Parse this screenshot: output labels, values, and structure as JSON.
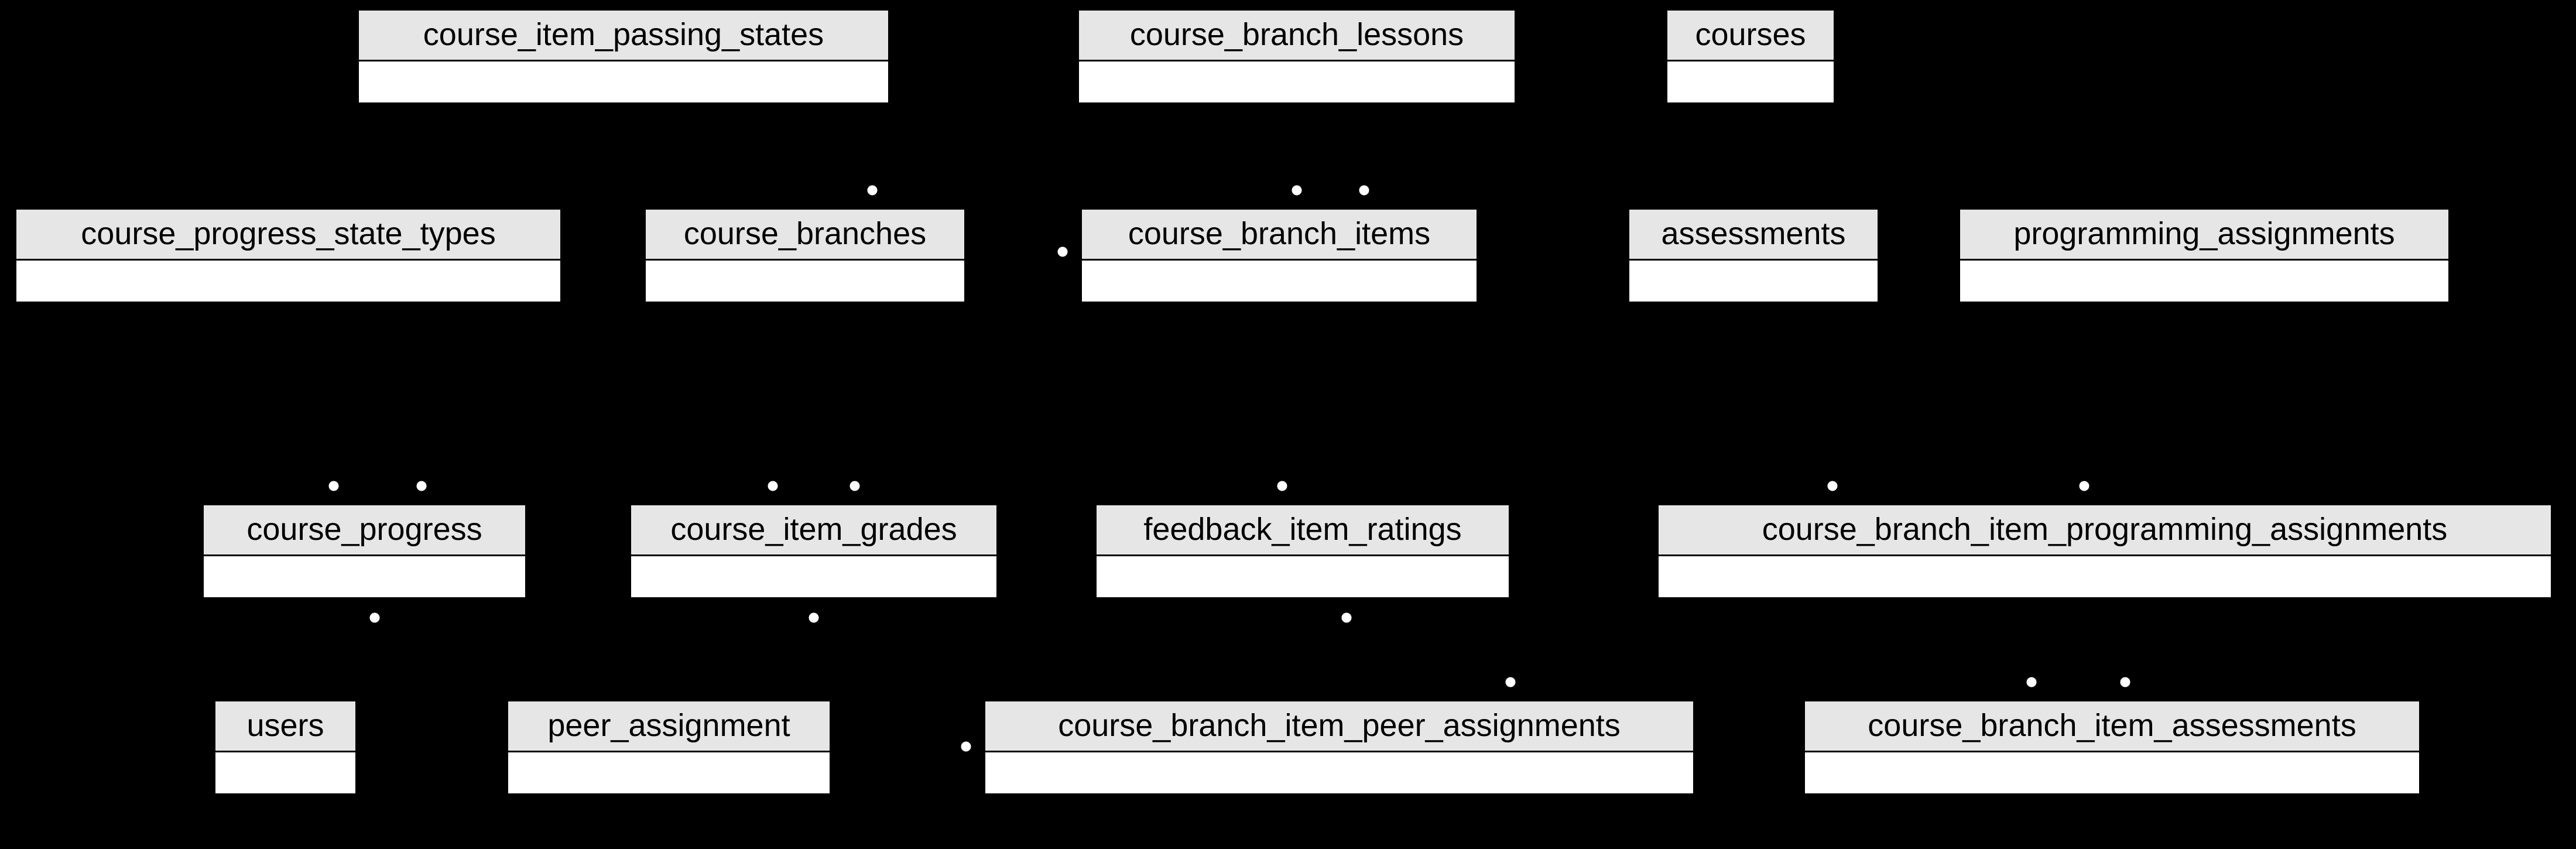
{
  "diagram": {
    "type": "entity-relationship",
    "entities": {
      "course_item_passing_states": {
        "label": "course_item_passing_states"
      },
      "course_branch_lessons": {
        "label": "course_branch_lessons"
      },
      "courses": {
        "label": "courses"
      },
      "course_progress_state_types": {
        "label": "course_progress_state_types"
      },
      "course_branches": {
        "label": "course_branches"
      },
      "course_branch_items": {
        "label": "course_branch_items"
      },
      "assessments": {
        "label": "assessments"
      },
      "programming_assignments": {
        "label": "programming_assignments"
      },
      "course_progress": {
        "label": "course_progress"
      },
      "course_item_grades": {
        "label": "course_item_grades"
      },
      "feedback_item_ratings": {
        "label": "feedback_item_ratings"
      },
      "course_branch_item_programming_assignments": {
        "label": "course_branch_item_programming_assignments"
      },
      "users": {
        "label": "users"
      },
      "peer_assignment": {
        "label": "peer_assignment"
      },
      "course_branch_item_peer_assignments": {
        "label": "course_branch_item_peer_assignments"
      },
      "course_branch_item_assessments": {
        "label": "course_branch_item_assessments"
      }
    },
    "edges": [
      {
        "from": "course_branch_lessons",
        "to": "course_branch_items"
      },
      {
        "from": "courses",
        "to": "course_branches"
      },
      {
        "from": "courses",
        "to": "course_branch_items"
      },
      {
        "from": "course_branches",
        "to": "course_branch_items"
      },
      {
        "from": "course_item_passing_states",
        "to": "course_item_grades"
      },
      {
        "from": "course_progress_state_types",
        "to": "course_progress"
      },
      {
        "from": "course_branch_items",
        "to": "course_progress"
      },
      {
        "from": "course_branch_items",
        "to": "course_item_grades"
      },
      {
        "from": "course_branch_items",
        "to": "feedback_item_ratings"
      },
      {
        "from": "course_branch_items",
        "to": "course_branch_item_programming_assignments"
      },
      {
        "from": "course_branch_items",
        "to": "course_branch_item_peer_assignments"
      },
      {
        "from": "course_branch_items",
        "to": "course_branch_item_assessments"
      },
      {
        "from": "assessments",
        "to": "course_branch_item_assessments"
      },
      {
        "from": "programming_assignments",
        "to": "course_branch_item_programming_assignments"
      },
      {
        "from": "users",
        "to": "course_progress"
      },
      {
        "from": "users",
        "to": "course_item_grades"
      },
      {
        "from": "users",
        "to": "feedback_item_ratings"
      },
      {
        "from": "peer_assignment",
        "to": "course_branch_item_peer_assignments"
      }
    ]
  }
}
